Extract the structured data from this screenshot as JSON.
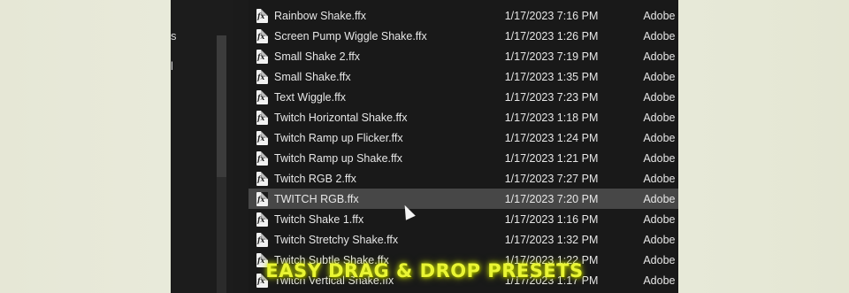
{
  "nav": {
    "items": [
      {
        "label": "s"
      },
      {
        "label": "l"
      }
    ]
  },
  "files": [
    {
      "name": "Rainbow Shake.ffx",
      "date": "1/17/2023 7:16 PM",
      "type": "Adobe"
    },
    {
      "name": "Screen Pump Wiggle Shake.ffx",
      "date": "1/17/2023 1:26 PM",
      "type": "Adobe"
    },
    {
      "name": "Small Shake 2.ffx",
      "date": "1/17/2023 7:19 PM",
      "type": "Adobe"
    },
    {
      "name": "Small Shake.ffx",
      "date": "1/17/2023 1:35 PM",
      "type": "Adobe"
    },
    {
      "name": "Text Wiggle.ffx",
      "date": "1/17/2023 7:23 PM",
      "type": "Adobe"
    },
    {
      "name": "Twitch Horizontal Shake.ffx",
      "date": "1/17/2023 1:18 PM",
      "type": "Adobe"
    },
    {
      "name": "Twitch Ramp up Flicker.ffx",
      "date": "1/17/2023 1:24 PM",
      "type": "Adobe"
    },
    {
      "name": "Twitch Ramp up Shake.ffx",
      "date": "1/17/2023 1:21 PM",
      "type": "Adobe"
    },
    {
      "name": "Twitch RGB 2.ffx",
      "date": "1/17/2023 7:27 PM",
      "type": "Adobe"
    },
    {
      "name": "TWITCH RGB.ffx",
      "date": "1/17/2023 7:20 PM",
      "type": "Adobe"
    },
    {
      "name": "Twitch Shake 1.ffx",
      "date": "1/17/2023 1:16 PM",
      "type": "Adobe"
    },
    {
      "name": "Twitch Stretchy Shake.ffx",
      "date": "1/17/2023 1:32 PM",
      "type": "Adobe"
    },
    {
      "name": "Twitch Subtle Shake.ffx",
      "date": "1/17/2023 1:22 PM",
      "type": "Adobe"
    },
    {
      "name": "Twitch Vertical Shake.ffx",
      "date": "1/17/2023 1:17 PM",
      "type": "Adobe"
    }
  ],
  "selected_index": 9,
  "icon": {
    "name": "ffx-file-icon",
    "glyph": "fx"
  },
  "caption": "EASY DRAG & DROP PRESETS",
  "colors": {
    "caption": "#e9f533",
    "selected_row": "#474747"
  }
}
